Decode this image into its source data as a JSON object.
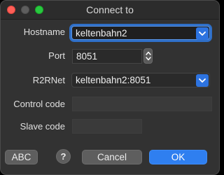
{
  "window": {
    "title": "Connect to"
  },
  "form": {
    "hostname": {
      "label": "Hostname",
      "value": "keltenbahn2"
    },
    "port": {
      "label": "Port",
      "value": "8051"
    },
    "r2rnet": {
      "label": "R2RNet",
      "value": "keltenbahn2:8051"
    },
    "control_code": {
      "label": "Control code",
      "value": ""
    },
    "slave_code": {
      "label": "Slave code",
      "value": ""
    }
  },
  "buttons": {
    "abc": "ABC",
    "help": "?",
    "cancel": "Cancel",
    "ok": "OK"
  },
  "colors": {
    "accent": "#2f7ff0",
    "close": "#ff5f57",
    "zoom": "#28c840"
  }
}
